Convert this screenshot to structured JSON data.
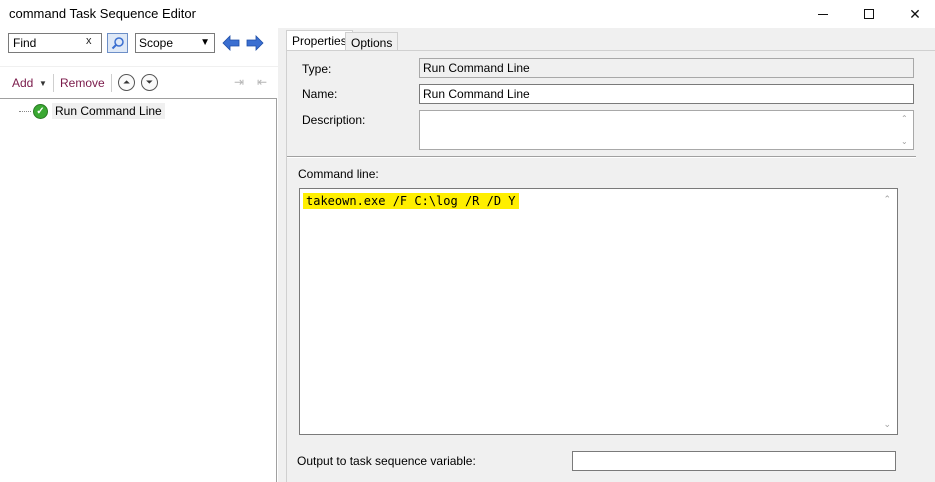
{
  "window": {
    "title": "command Task Sequence Editor"
  },
  "toolbar": {
    "find_value": "Find",
    "find_clear": "x",
    "scope_value": "Scope"
  },
  "actions": {
    "add_label": "Add",
    "remove_label": "Remove"
  },
  "tree": {
    "items": [
      {
        "label": "Run Command Line",
        "status": "success"
      }
    ]
  },
  "tabs": [
    {
      "label": "Properties",
      "active": true
    },
    {
      "label": "Options",
      "active": false
    }
  ],
  "properties": {
    "type_label": "Type:",
    "type_value": "Run Command Line",
    "name_label": "Name:",
    "name_value": "Run Command Line",
    "description_label": "Description:",
    "description_value": "",
    "command_line_label": "Command line:",
    "command_line_value": "takeown.exe /F C:\\log /R /D Y",
    "output_label": "Output to task sequence variable:",
    "output_value": ""
  },
  "colors": {
    "highlight": "#ffef00",
    "action_text": "#7a1a4a",
    "nav_arrow": "#3b6fd1",
    "success": "#3aa832"
  },
  "icons": {
    "search": "magnifier-icon",
    "back": "arrow-left-icon",
    "forward": "arrow-right-icon",
    "move_up": "move-up-icon",
    "move_down": "move-down-icon",
    "status": "check-circle-icon"
  }
}
